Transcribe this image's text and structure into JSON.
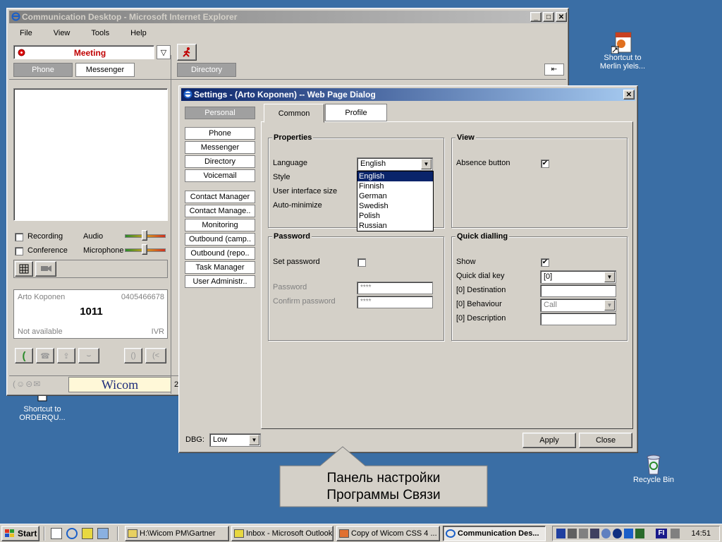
{
  "colors": {
    "desktop": "#3a6ea5",
    "title_active": "#0a246a",
    "meeting_red": "#c00000",
    "wicom_blue": "#1a2a7a"
  },
  "ie_window": {
    "title": "Communication Desktop - Microsoft Internet Explorer",
    "menu": [
      "File",
      "View",
      "Tools",
      "Help"
    ],
    "status_value": "Meeting",
    "tabs": {
      "phone": "Phone",
      "messenger": "Messenger"
    },
    "directory_tab": "Directory",
    "options": {
      "recording": "Recording",
      "conference": "Conference",
      "audio": "Audio",
      "microphone": "Microphone"
    },
    "caller": {
      "name": "Arto Koponen",
      "phone": "0405466678",
      "number": "1011",
      "status": "Not available",
      "mode": "IVR"
    },
    "brand": "Wicom",
    "page_indicator": "2"
  },
  "dialog": {
    "title": "Settings - (Arto Koponen) -- Web Page Dialog",
    "nav": {
      "personal": "Personal",
      "group1": [
        "Phone",
        "Messenger",
        "Directory",
        "Voicemail"
      ],
      "group2": [
        "Contact Manager",
        "Contact Manage..",
        "Monitoring",
        "Outbound (camp..",
        "Outbound (repo..",
        "Task Manager",
        "User Administr.."
      ]
    },
    "tabs": {
      "common": "Common",
      "profile": "Profile"
    },
    "properties": {
      "legend": "Properties",
      "language_label": "Language",
      "language_value": "English",
      "style_label": "Style",
      "ui_size_label": "User interface size",
      "auto_minimize_label": "Auto-minimize",
      "language_options": [
        "English",
        "Finnish",
        "German",
        "Swedish",
        "Polish",
        "Russian"
      ]
    },
    "view": {
      "legend": "View",
      "absence_label": "Absence button",
      "absence_checked": "✔"
    },
    "password": {
      "legend": "Password",
      "set_label": "Set password",
      "password_label": "Password",
      "password_value": "****",
      "confirm_label": "Confirm password",
      "confirm_value": "****"
    },
    "quick": {
      "legend": "Quick dialling",
      "show_label": "Show",
      "show_checked": "✔",
      "key_label": "Quick dial key",
      "key_value": "[0]",
      "dest_label": "[0] Destination",
      "behaviour_label": "[0] Behaviour",
      "behaviour_value": "Call",
      "desc_label": "[0] Description"
    },
    "dbg_label": "DBG:",
    "dbg_value": "Low",
    "apply": "Apply",
    "close": "Close"
  },
  "callout": {
    "line1": "Панель настройки",
    "line2": "Программы Связи"
  },
  "desktop_icons": {
    "merlin": {
      "line1": "Shortcut to",
      "line2": "Merlin yleis..."
    },
    "orderqu": {
      "line1": "Shortcut to",
      "line2": "ORDERQU..."
    },
    "recycle": "Recycle Bin"
  },
  "taskbar": {
    "start": "Start",
    "tasks": [
      "H:\\Wicom PM\\Gartner",
      "Inbox - Microsoft Outlook",
      "Copy of Wicom CSS 4 ...",
      "Communication Des..."
    ],
    "lang": "FI",
    "time": "14:51"
  }
}
